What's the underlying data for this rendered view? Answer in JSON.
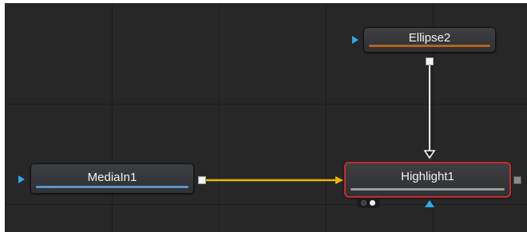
{
  "nodes": {
    "ellipse2": {
      "label": "Ellipse2",
      "bar_color": "#b5651d"
    },
    "mediain1": {
      "label": "MediaIn1",
      "bar_color": "#5f95c6"
    },
    "highlight1": {
      "label": "Highlight1",
      "bar_color": "#9a9a9a",
      "selected": true,
      "selection_color": "#c92b2b"
    }
  },
  "connections": [
    {
      "from": "mediain1",
      "to": "highlight1",
      "color": "#e6b800",
      "type": "image"
    },
    {
      "from": "ellipse2",
      "to": "highlight1",
      "color": "#f3f3f3",
      "type": "mask"
    }
  ],
  "colors": {
    "canvas_bg": "#272727",
    "grid_line": "#1c1c1c",
    "input_port": "#2fa8e8",
    "image_link": "#e6b800",
    "mask_link": "#f3f3f3"
  },
  "icons": {
    "input_port": "blue-triangle",
    "output_port": "square",
    "view_indicator": "two-dots"
  }
}
